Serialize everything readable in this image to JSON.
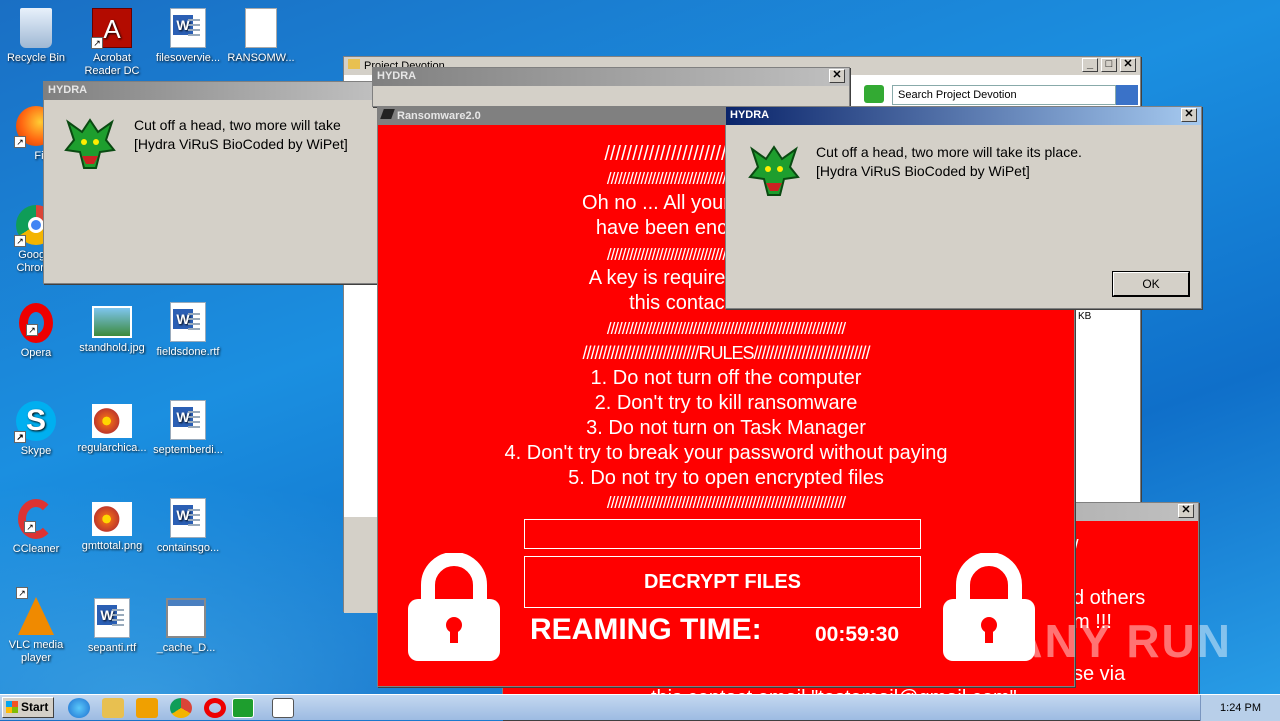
{
  "desktop": {
    "icons": [
      {
        "label": "Recycle Bin"
      },
      {
        "label": "Acrobat Reader DC"
      },
      {
        "label": "filesovervie..."
      },
      {
        "label": "RANSOMW..."
      },
      {
        "label": "Firefox"
      },
      {
        "label": "Google Chrome"
      },
      {
        "label": "Opera"
      },
      {
        "label": "standhold.jpg"
      },
      {
        "label": "fieldsdone.rtf"
      },
      {
        "label": "Skype"
      },
      {
        "label": "regularchica..."
      },
      {
        "label": "septemberdi..."
      },
      {
        "label": "CCleaner"
      },
      {
        "label": "gmttotal.png"
      },
      {
        "label": "containsgo..."
      },
      {
        "label": "VLC media player"
      },
      {
        "label": "sepanti.rtf"
      },
      {
        "label": "_cache_D..."
      }
    ]
  },
  "explorer": {
    "title": "Project Devotion",
    "search_placeholder": "Search Project Devotion",
    "size_text": "KB"
  },
  "hydra1": {
    "title": "HYDRA",
    "line1": "Cut off a head, two more will take",
    "line2": "[Hydra ViRuS BioCoded by WiPet]"
  },
  "hydra2": {
    "title": "HYDRA"
  },
  "hydra3": {
    "title": "HYDRA",
    "line1": "Cut off a head, two more will take its place.",
    "line2": "[Hydra ViRuS BioCoded by WiPet]",
    "ok": "OK"
  },
  "ransom_back": {
    "line_a": "/",
    "line_b": "d others",
    "line_c": "m !!!",
    "line_d": "se via",
    "email": "this contact email \"testemail@gmail.com\""
  },
  "ransom": {
    "title": "Ransomware2.0",
    "header": "////////////////////////////RANSOM",
    "slashes": "////////////////////////////////////////////////////////////////",
    "line1": "Oh no ... All your documents, vid",
    "line2": "have been encrypted with a s",
    "line3": "A key is required for decryption",
    "line4": "this contact email \"tes",
    "rules_header": "/////////////////////////////RULES/////////////////////////////",
    "rules": [
      "1. Do not turn off the computer",
      "2. Don't try to kill ransomware",
      "3. Do not turn on Task Manager",
      "4. Don't try to break your password without paying",
      "5. Do not try to open encrypted files"
    ],
    "decrypt_label": "DECRYPT FILES",
    "timer_label": "REAMING TIME:",
    "timer_value": "00:59:30"
  },
  "taskbar": {
    "start": "Start",
    "clock": "1:24 PM"
  },
  "watermark": "ANY RUN",
  "colors": {
    "ransom_red": "#ff0000",
    "titlebar_active": "#0a246a"
  }
}
